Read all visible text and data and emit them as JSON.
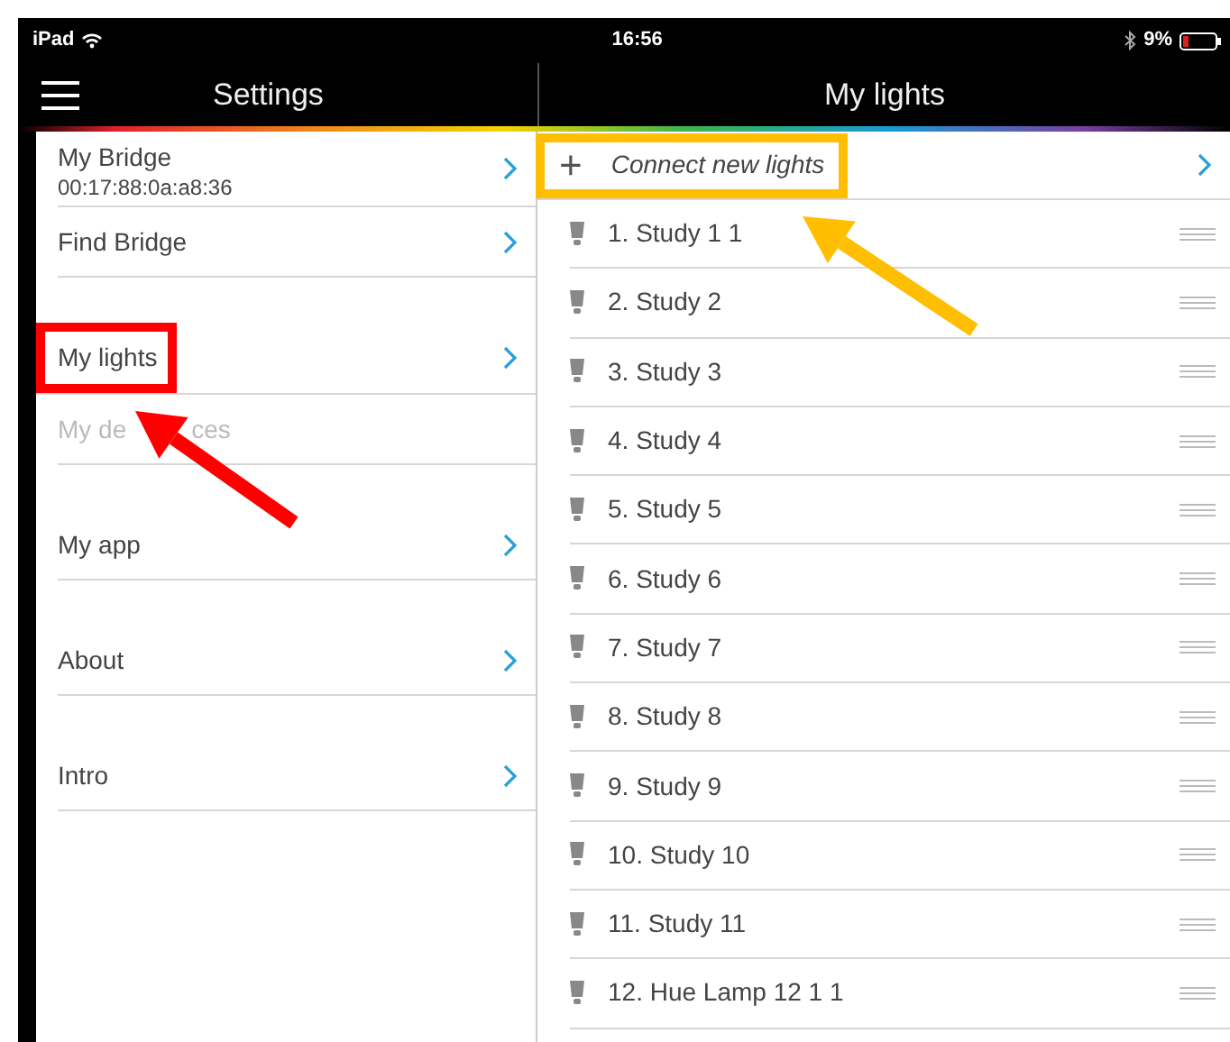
{
  "status_bar": {
    "device": "iPad",
    "time": "16:56",
    "battery": "9%"
  },
  "settings": {
    "title": "Settings",
    "sections": [
      {
        "items": [
          {
            "label": "My Bridge",
            "subtitle": "00:17:88:0a:a8:36",
            "disabled": false
          },
          {
            "label": "Find Bridge",
            "disabled": false
          }
        ]
      },
      {
        "items": [
          {
            "label": "My lights",
            "disabled": false,
            "color": "#ff0000"
          },
          {
            "label": "My de",
            "label_end": "ces",
            "disabled": true
          }
        ]
      },
      {
        "items": [
          {
            "label": "My app",
            "disabled": false
          }
        ]
      },
      {
        "items": [
          {
            "label": "About",
            "disabled": false
          }
        ]
      },
      {
        "items": [
          {
            "label": "Intro",
            "disabled": false
          }
        ]
      }
    ]
  },
  "lights_panel": {
    "title": "My lights",
    "connect": {
      "icon": "+",
      "label": "Connect new lights",
      "color": "#ffbf00"
    },
    "lights": [
      "1. Study 1 1",
      "2. Study 2",
      "3. Study 3",
      "4. Study 4",
      "5. Study 5",
      "6. Study 6",
      "7. Study 7",
      "8. Study 8",
      "9. Study 9",
      "10. Study 10",
      "11. Study 11",
      "12. Hue Lamp 12 1 1"
    ]
  }
}
